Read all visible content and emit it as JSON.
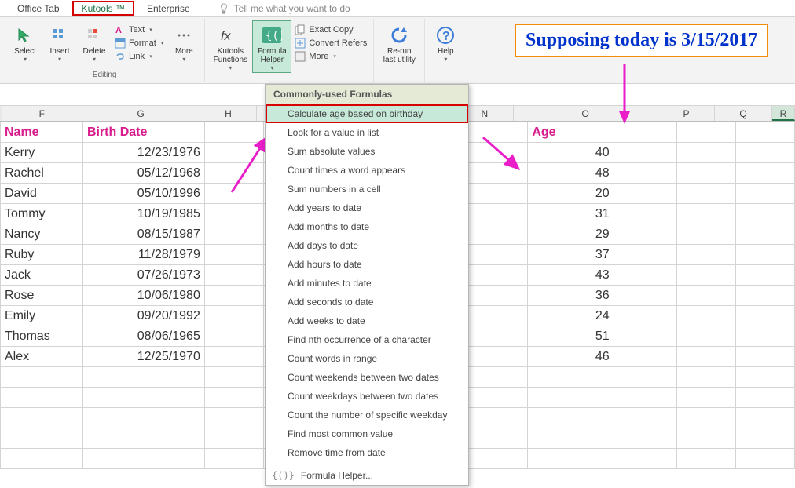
{
  "tabs": {
    "office": "Office Tab",
    "kutools": "Kutools ™",
    "enterprise": "Enterprise",
    "tellme": "Tell me what you want to do"
  },
  "ribbon": {
    "select": "Select",
    "insert": "Insert",
    "delete": "Delete",
    "text": "Text",
    "format": "Format",
    "link": "Link",
    "more": "More",
    "editing_group": "Editing",
    "functions": "Kutools\nFunctions",
    "formula_helper": "Formula\nHelper",
    "exact_copy": "Exact Copy",
    "convert_refers": "Convert Refers",
    "more2": "More",
    "rerun": "Re-run\nlast utility",
    "help": "Help"
  },
  "columns": [
    "F",
    "G",
    "H",
    "",
    "",
    "",
    "N",
    "O",
    "P",
    "Q",
    "R"
  ],
  "headers": {
    "name": "Name",
    "birth": "Birth Date",
    "age": "Age"
  },
  "data": [
    {
      "name": "Kerry",
      "birth": "12/23/1976",
      "age": "40"
    },
    {
      "name": "Rachel",
      "birth": "05/12/1968",
      "age": "48"
    },
    {
      "name": "David",
      "birth": "05/10/1996",
      "age": "20"
    },
    {
      "name": "Tommy",
      "birth": "10/19/1985",
      "age": "31"
    },
    {
      "name": "Nancy",
      "birth": "08/15/1987",
      "age": "29"
    },
    {
      "name": "Ruby",
      "birth": "11/28/1979",
      "age": "37"
    },
    {
      "name": "Jack",
      "birth": "07/26/1973",
      "age": "43"
    },
    {
      "name": "Rose",
      "birth": "10/06/1980",
      "age": "36"
    },
    {
      "name": "Emily",
      "birth": "09/20/1992",
      "age": "24"
    },
    {
      "name": "Thomas",
      "birth": "08/06/1965",
      "age": "51"
    },
    {
      "name": "Alex",
      "birth": "12/25/1970",
      "age": "46"
    }
  ],
  "dropdown": {
    "header": "Commonly-used Formulas",
    "highlighted": "Calculate age based on birthday",
    "items": [
      "Look for a value in list",
      "Sum absolute values",
      "Count times a word appears",
      "Sum numbers in a cell",
      "Add years to date",
      "Add months to date",
      "Add days to date",
      "Add hours to date",
      "Add minutes to date",
      "Add seconds to date",
      "Add weeks to date",
      "Find nth occurrence of a character",
      "Count words in range",
      "Count weekends between two dates",
      "Count weekdays between two dates",
      "Count the number of specific weekday",
      "Find most common value",
      "Remove time from date"
    ],
    "last": "Formula Helper..."
  },
  "callout": "Supposing today is 3/15/2017",
  "col_widths": {
    "F": 105,
    "G": 155,
    "H": 75,
    "hidden": 335,
    "N": 75,
    "O": 190,
    "P": 75,
    "Q": 75,
    "R": 30
  }
}
